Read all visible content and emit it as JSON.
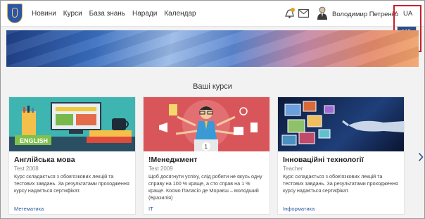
{
  "nav": [
    "Новини",
    "Курси",
    "База знань",
    "Наради",
    "Календар"
  ],
  "user": {
    "name": "Володимир Петренко"
  },
  "language": {
    "current": "UA",
    "options": [
      "UA",
      "EN"
    ]
  },
  "section_title": "Ваші курси",
  "courses": [
    {
      "title": "Англійська мова",
      "subtitle": "Test 2008",
      "description": "Курс складається з обов'язкових лекцій та тестових завдань. За результатами проходження курсу надається сертифікат.",
      "category": "Метематика",
      "image_text": "ENGLISH"
    },
    {
      "title": "!Менеджмент",
      "subtitle": "Test 2009",
      "description": "Щоб досягнути успіху, слід робити не якусь одну справу на 100 % краще, а сто справ на 1 % краще. Космо Паласіо де Мораєш – молодший (Бразилія)",
      "category": "IT",
      "image_text": "1"
    },
    {
      "title": "Інноваційні технології",
      "subtitle": "Teacher",
      "description": "Курс складається з обов'язкових лекцій та тестових завдань. За результатами проходження курсу надається сертифікат.",
      "category": "Інформатика",
      "image_text": ""
    }
  ],
  "colors": {
    "brand": "#2b4f8d",
    "highlight": "#c5202e",
    "link": "#2b5aa0"
  }
}
